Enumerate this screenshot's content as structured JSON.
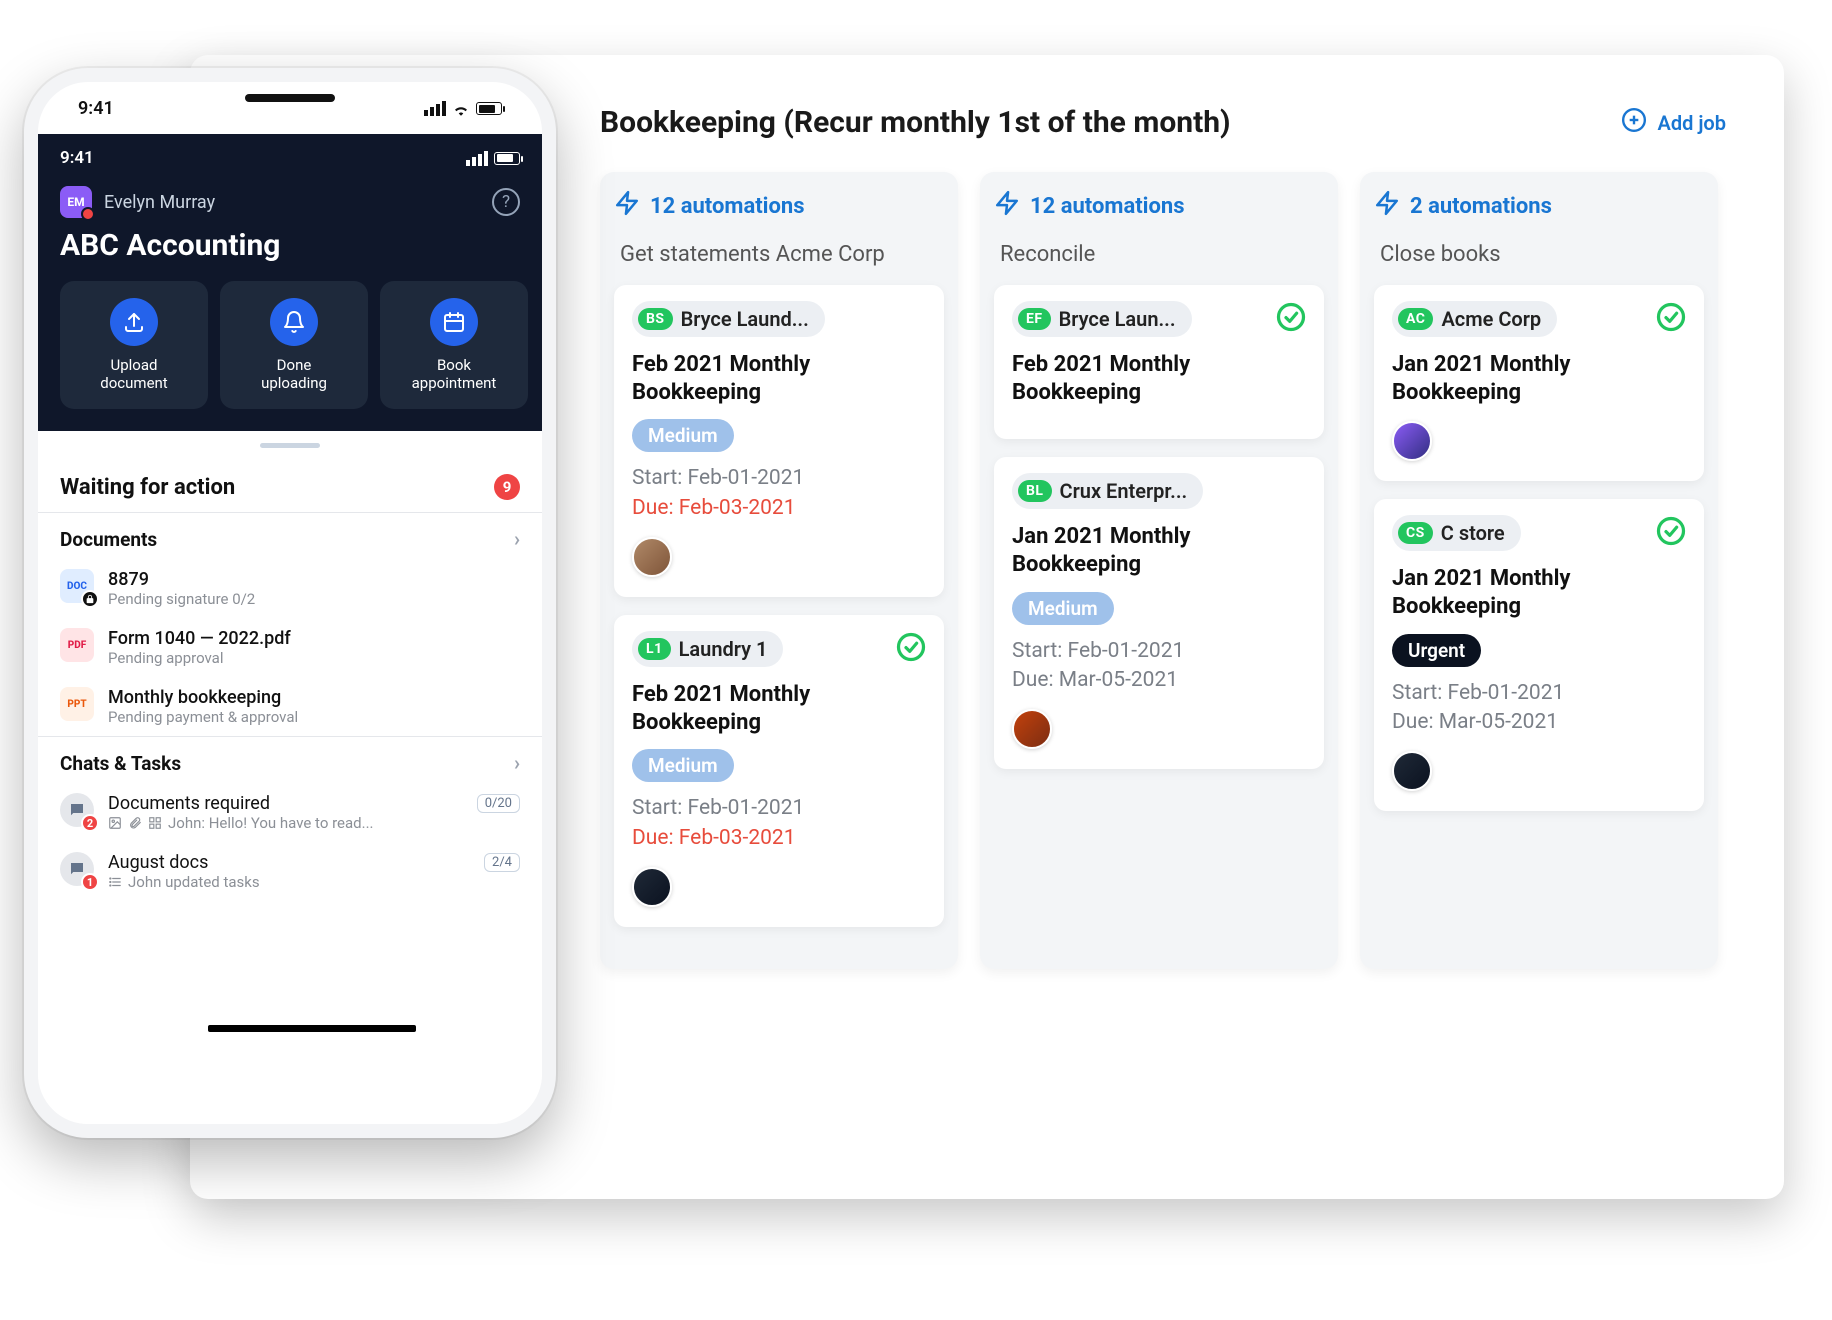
{
  "desktop": {
    "title": "Bookkeeping (Recur monthly 1st of the month)",
    "add_job_label": "Add job",
    "columns": [
      {
        "automations": "12 automations",
        "name": "Get statements Acme Corp",
        "cards": [
          {
            "tag_abbr": "BS",
            "tag_label": "Bryce Laund...",
            "check": false,
            "title": "Feb 2021 Monthly Bookkeeping",
            "priority": "Medium",
            "priority_kind": "medium",
            "start": "Start: Feb-01-2021",
            "due": "Due: Feb-03-2021",
            "due_red": true,
            "avatar_variant": "v1"
          },
          {
            "tag_abbr": "L1",
            "tag_label": "Laundry 1",
            "check": true,
            "title": "Feb 2021 Monthly Bookkeeping",
            "priority": "Medium",
            "priority_kind": "medium",
            "start": "Start: Feb-01-2021",
            "due": "Due: Feb-03-2021",
            "due_red": true,
            "avatar_variant": "v3"
          }
        ]
      },
      {
        "automations": "12 automations",
        "name": "Reconcile",
        "cards": [
          {
            "tag_abbr": "EF",
            "tag_label": "Bryce Laun...",
            "check": true,
            "title": "Feb 2021 Monthly Bookkeeping",
            "avatar_variant": null
          },
          {
            "tag_abbr": "BL",
            "tag_label": "Crux Enterpr...",
            "check": false,
            "title": "Jan 2021 Monthly Bookkeeping",
            "priority": "Medium",
            "priority_kind": "medium",
            "start": "Start: Feb-01-2021",
            "due": "Due: Mar-05-2021",
            "due_red": false,
            "avatar_variant": "v2"
          }
        ]
      },
      {
        "automations": "2 automations",
        "name": "Close books",
        "cards": [
          {
            "tag_abbr": "AC",
            "tag_label": "Acme Corp",
            "check": true,
            "title": "Jan 2021 Monthly Bookkeeping",
            "avatar_variant": "v4"
          },
          {
            "tag_abbr": "CS",
            "tag_label": "C store",
            "check": true,
            "title": "Jan 2021 Monthly Bookkeeping",
            "priority": "Urgent",
            "priority_kind": "urgent",
            "start": "Start: Feb-01-2021",
            "due": "Due: Mar-05-2021",
            "due_red": false,
            "avatar_variant": "v3"
          }
        ]
      }
    ]
  },
  "phone": {
    "frame_time": "9:41",
    "inner_time": "9:41",
    "user_initials": "EM",
    "user_name": "Evelyn Murray",
    "firm_name": "ABC Accounting",
    "tiles": [
      {
        "label": "Upload\ndocument",
        "icon": "upload"
      },
      {
        "label": "Done\nuploading",
        "icon": "bell"
      },
      {
        "label": "Book\nappointment",
        "icon": "calendar"
      }
    ],
    "waiting_title": "Waiting for action",
    "waiting_count": "9",
    "documents_header": "Documents",
    "documents": [
      {
        "icon": "doc",
        "locked": true,
        "title": "8879",
        "sub": "Pending signature 0/2"
      },
      {
        "icon": "pdf",
        "locked": false,
        "title": "Form 1040 — 2022.pdf",
        "sub": "Pending approval"
      },
      {
        "icon": "ppt",
        "locked": false,
        "title": "Monthly bookkeeping",
        "sub": "Pending payment & approval"
      }
    ],
    "chats_header": "Chats & Tasks",
    "chats": [
      {
        "badge": "2",
        "title": "Documents required",
        "count": "0/20",
        "sub": "John: Hello! You have to read..."
      },
      {
        "badge": "1",
        "title": "August docs",
        "count": "2/4",
        "sub": "John updated tasks"
      }
    ]
  }
}
